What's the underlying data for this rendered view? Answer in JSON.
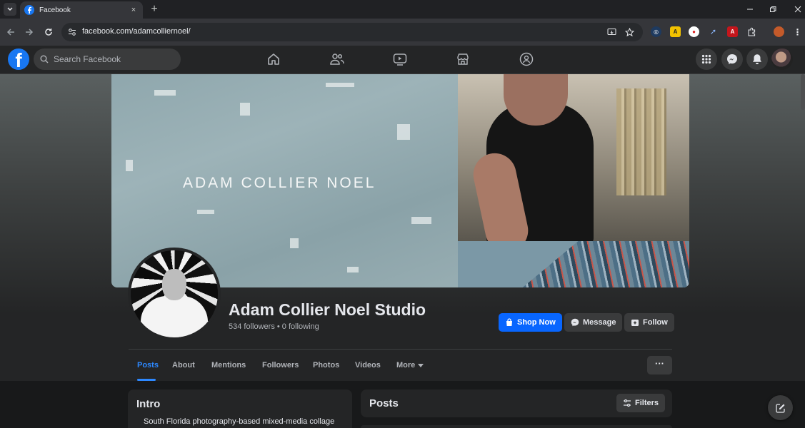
{
  "browser": {
    "tab_title": "Facebook",
    "url": "facebook.com/adamcolliernoel/",
    "new_tab": "+",
    "tab_close": "×"
  },
  "fb_header": {
    "logo_letter": "f",
    "search_placeholder": "Search Facebook"
  },
  "cover": {
    "title": "ADAM COLLIER NOEL"
  },
  "profile": {
    "name": "Adam Collier Noel Studio",
    "stats": "534 followers • 0 following"
  },
  "actions": {
    "shop_now": "Shop Now",
    "message": "Message",
    "follow": "Follow"
  },
  "tabs": {
    "items": [
      "Posts",
      "About",
      "Mentions",
      "Followers",
      "Photos",
      "Videos",
      "More"
    ],
    "more_dots": "···"
  },
  "intro": {
    "title": "Intro",
    "text": "South Florida photography-based mixed-media collage"
  },
  "posts": {
    "title": "Posts",
    "filters": "Filters"
  },
  "colors": {
    "accent": "#0866ff",
    "tab_active": "#2d88ff",
    "surface": "#242526",
    "background": "#18191a"
  }
}
